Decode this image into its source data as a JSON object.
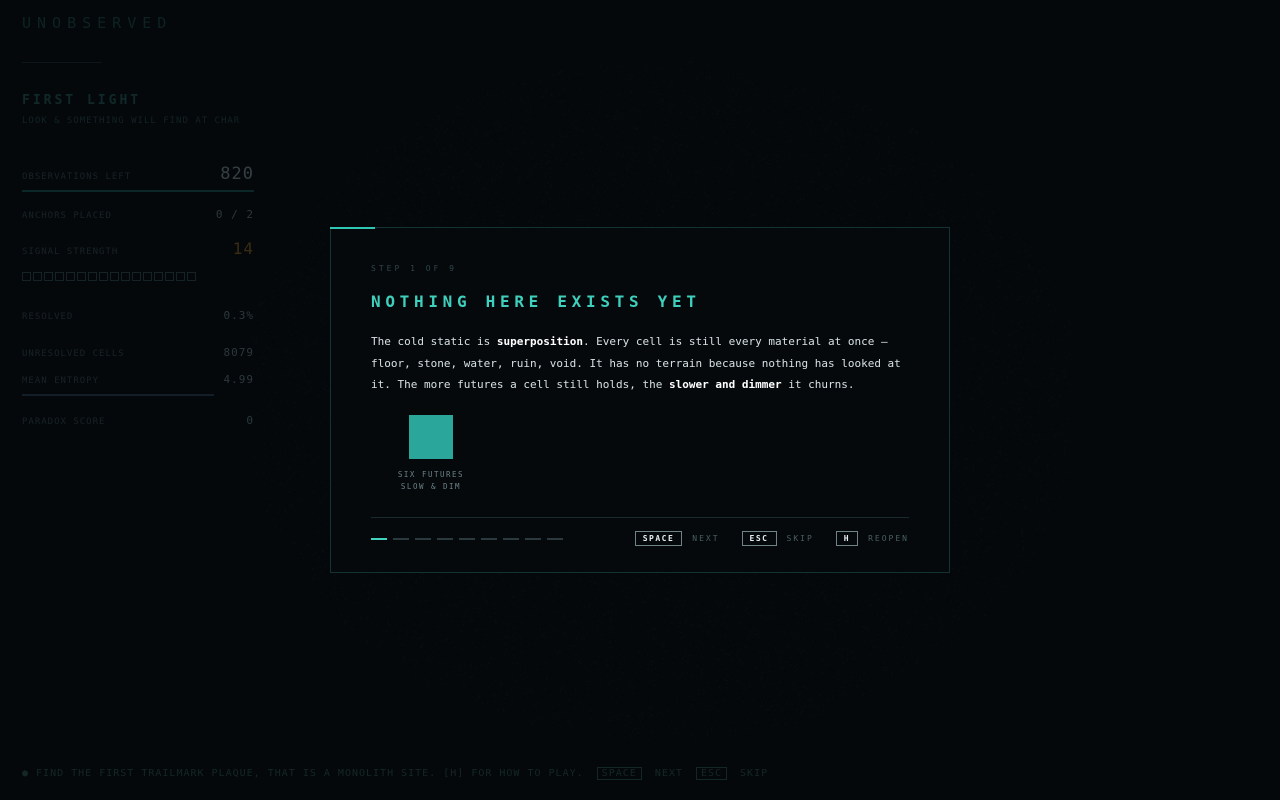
{
  "hud": {
    "game_title": "UNOBSERVED",
    "chapter_title": "FIRST LIGHT",
    "chapter_subtitle": "LOOK & SOMETHING WILL FIND AT CHAR",
    "observation_label": "OBSERVATIONS LEFT",
    "observation_value": "820",
    "anchors_label": "ANCHORS PLACED",
    "anchors_value": "0 / 2",
    "signal_label": "SIGNAL STRENGTH",
    "signal_value": "14",
    "resolved_label": "RESOLVED",
    "resolved_value": "0.3%",
    "unresolved_label": "UNRESOLVED CELLS",
    "unresolved_value": "8079",
    "mean_entropy_label": "MEAN ENTROPY",
    "mean_entropy_value": "4.99",
    "paradox_label": "PARADOX SCORE",
    "paradox_value": "0",
    "signal_squares": 16
  },
  "footer": {
    "text": "● FIND THE FIRST TRAILMARK PLAQUE, THAT IS A MONOLITH SITE. [H] FOR HOW TO PLAY.",
    "key1": "SPACE",
    "key1_label": "NEXT",
    "key2": "ESC",
    "key2_label": "SKIP"
  },
  "tutorial": {
    "step_label": "STEP 1 OF 9",
    "title": "NOTHING HERE EXISTS YET",
    "p_1": "The cold static is ",
    "b_1": "superposition",
    "p_2": ". Every cell is still every material at once — floor, stone, water, ruin, void. It has no terrain because nothing has looked at it. The more futures a cell still holds, the ",
    "b_2": "slower and dimmer",
    "p_3": " it churns.",
    "swatch_caption_1": "SIX FUTURES",
    "swatch_caption_2": "SLOW & DIM",
    "swatch_color": "#2aa69a",
    "total_steps": 9,
    "current_step": 1,
    "key_next": "SPACE",
    "key_next_label": "NEXT",
    "key_skip": "ESC",
    "key_skip_label": "SKIP",
    "key_reopen": "H",
    "key_reopen_label": "REOPEN"
  },
  "colors": {
    "accent": "#40d3c0",
    "background": "#05080b",
    "amber": "#a77a22"
  }
}
